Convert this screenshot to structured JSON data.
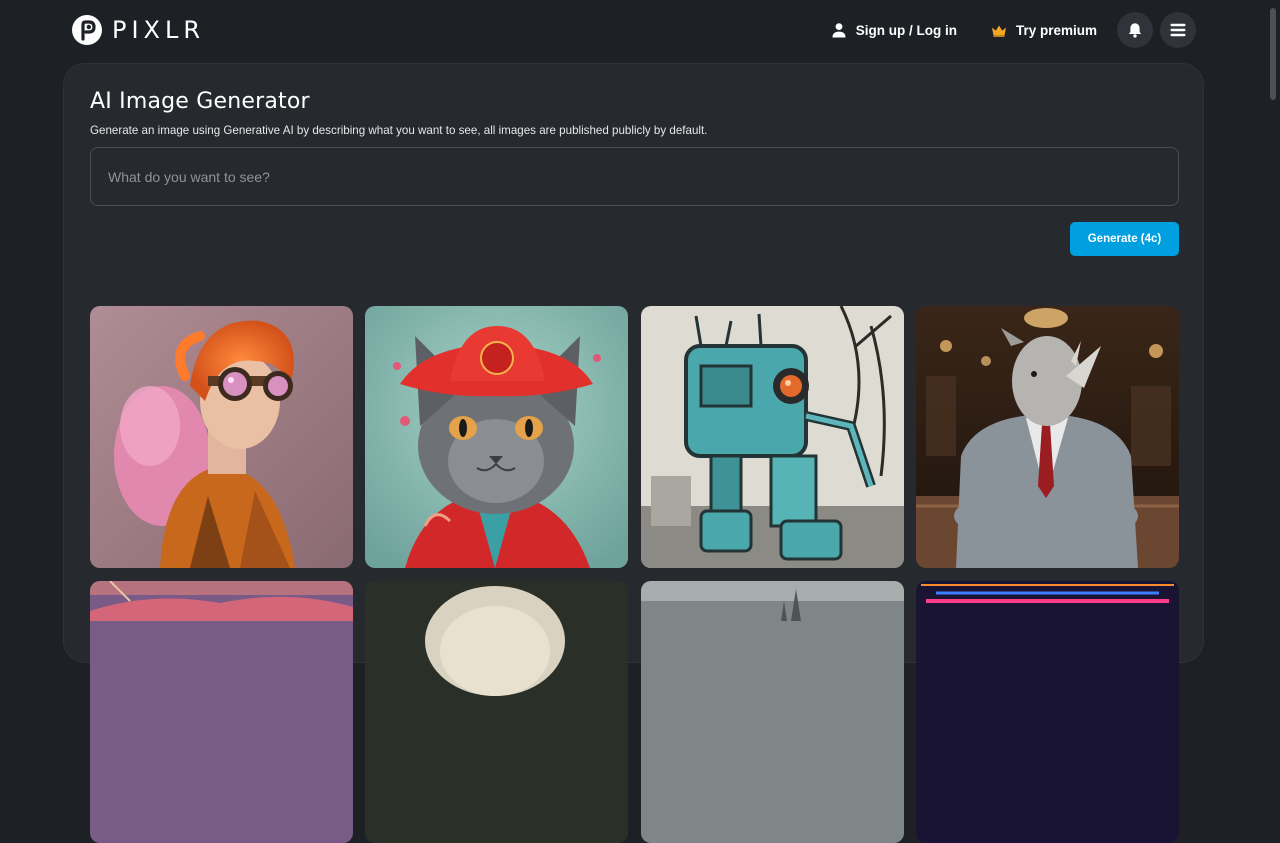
{
  "header": {
    "logo_text": "PIXLR",
    "signup_label": "Sign up / Log in",
    "premium_label": "Try premium",
    "icons": [
      "pixlr-logo-icon",
      "user-icon",
      "crown-icon",
      "bell-icon",
      "menu-icon"
    ],
    "colors": {
      "crown": "#f5a623",
      "button_bg": "#30343a"
    }
  },
  "main": {
    "title": "AI Image Generator",
    "subtitle": "Generate an image using Generative AI by describing what you want to see, all images are published publicly by default.",
    "prompt_placeholder": "What do you want to see?",
    "prompt_value": "",
    "generate_label": "Generate (4c)",
    "colors": {
      "accent": "#009fe0",
      "panel": "#26292e",
      "page": "#1d2024"
    }
  },
  "gallery": {
    "items": [
      {
        "subject": "steampunk-boy-image"
      },
      {
        "subject": "cat-red-hat-image"
      },
      {
        "subject": "robot-image"
      },
      {
        "subject": "rhino-suit-image"
      },
      {
        "subject": "sunset-scene-image"
      },
      {
        "subject": "blonde-portrait-image"
      },
      {
        "subject": "castle-landscape-image"
      },
      {
        "subject": "neon-scene-image"
      }
    ]
  }
}
